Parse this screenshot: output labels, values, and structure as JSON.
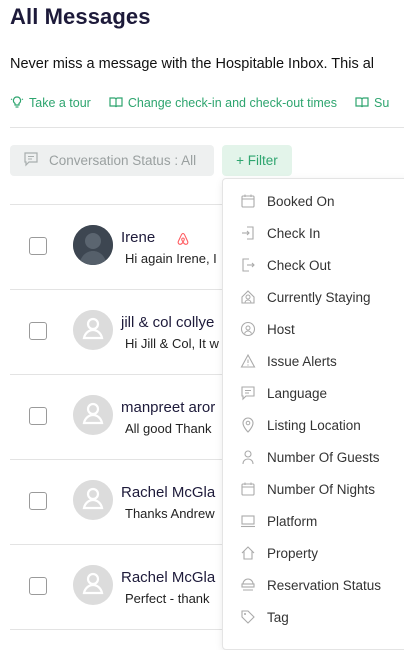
{
  "page": {
    "title": "All Messages",
    "subtitle": "Never miss a message with the Hospitable Inbox. This al"
  },
  "links": [
    {
      "label": "Take a tour",
      "icon": "lightbulb-icon"
    },
    {
      "label": "Change check-in and check-out times",
      "icon": "book-icon"
    },
    {
      "label": "Su",
      "icon": "book-icon"
    }
  ],
  "toolbar": {
    "status_label": "Conversation Status : All",
    "filter_label": "+ Filter"
  },
  "conversations": [
    {
      "name": "Irene",
      "preview": "Hi again Irene, I",
      "avatar": "photo",
      "platform_icon": "airbnb-icon"
    },
    {
      "name": "jill & col collye",
      "preview": "Hi Jill & Col, It w",
      "avatar": "placeholder"
    },
    {
      "name": "manpreet aror",
      "preview": "All good Thank",
      "avatar": "placeholder"
    },
    {
      "name": "Rachel McGla",
      "preview": "Thanks Andrew",
      "avatar": "placeholder"
    },
    {
      "name": "Rachel McGla",
      "preview": "Perfect - thank",
      "avatar": "placeholder"
    }
  ],
  "filter_menu": {
    "items": [
      {
        "label": "Booked On",
        "icon": "calendar-icon"
      },
      {
        "label": "Check In",
        "icon": "check-in-icon"
      },
      {
        "label": "Check Out",
        "icon": "check-out-icon"
      },
      {
        "label": "Currently Staying",
        "icon": "guest-icon"
      },
      {
        "label": "Host",
        "icon": "host-icon"
      },
      {
        "label": "Issue Alerts",
        "icon": "warning-icon"
      },
      {
        "label": "Language",
        "icon": "chat-icon"
      },
      {
        "label": "Listing Location",
        "icon": "location-pin-icon"
      },
      {
        "label": "Number Of Guests",
        "icon": "person-icon"
      },
      {
        "label": "Number Of Nights",
        "icon": "calendar-icon"
      },
      {
        "label": "Platform",
        "icon": "platform-icon"
      },
      {
        "label": "Property",
        "icon": "home-icon"
      },
      {
        "label": "Reservation Status",
        "icon": "reservation-icon"
      },
      {
        "label": "Tag",
        "icon": "tag-icon"
      }
    ]
  },
  "colors": {
    "accent": "#2ea56f",
    "title": "#1d1a3a",
    "muted": "#9aa0a0"
  }
}
